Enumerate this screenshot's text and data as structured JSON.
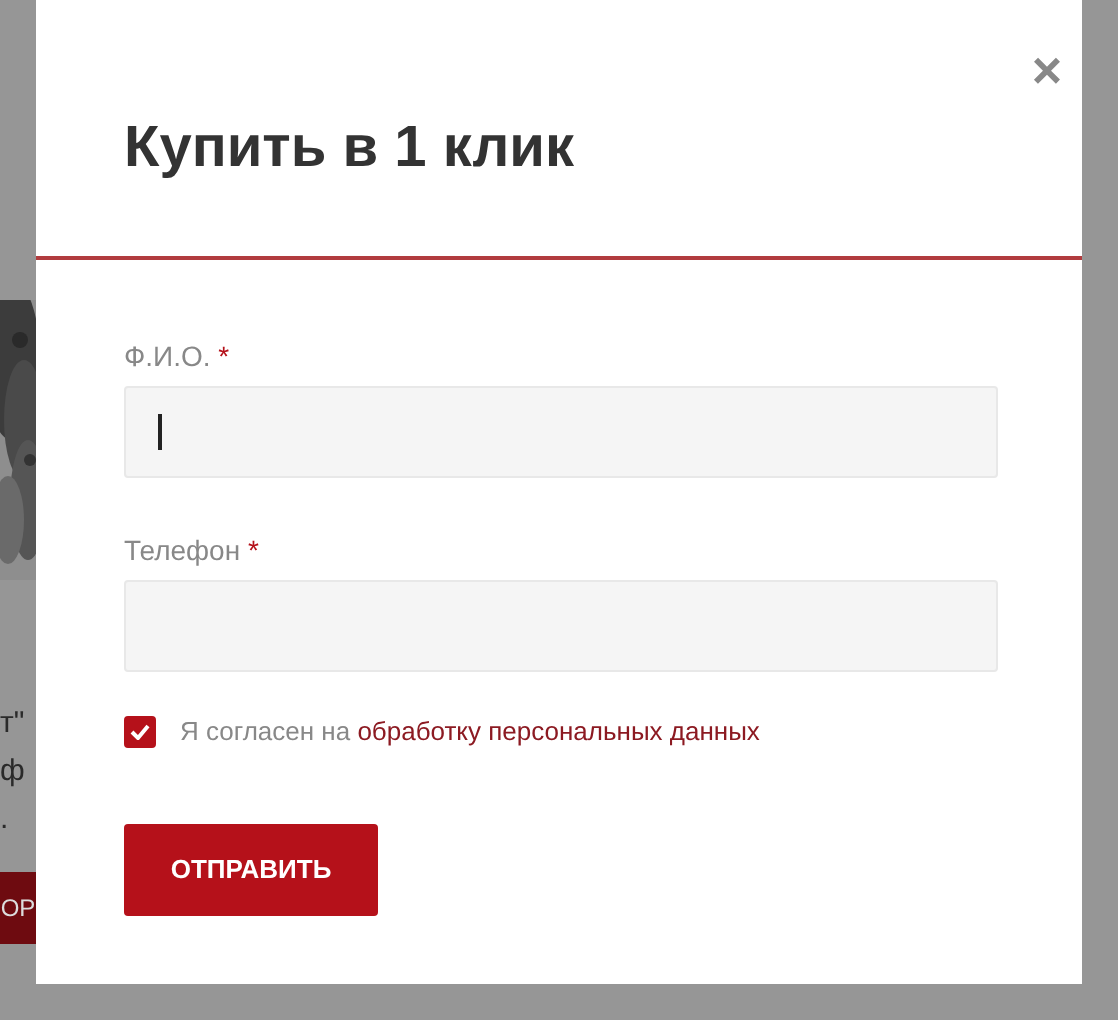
{
  "background_page": {
    "texts": [
      "т\"",
      "ф",
      "."
    ],
    "button": "ОР"
  },
  "modal": {
    "close": "×",
    "title": "Купить в 1 клик",
    "fields": [
      {
        "label": "Ф.И.О.",
        "required_mark": "*",
        "focused": true
      },
      {
        "label": "Телефон",
        "required_mark": "*",
        "focused": false
      }
    ],
    "consent": {
      "checked": true,
      "text": "Я согласен на",
      "link": "обработку персональных данных"
    },
    "submit": "ОТПРАВИТЬ"
  }
}
